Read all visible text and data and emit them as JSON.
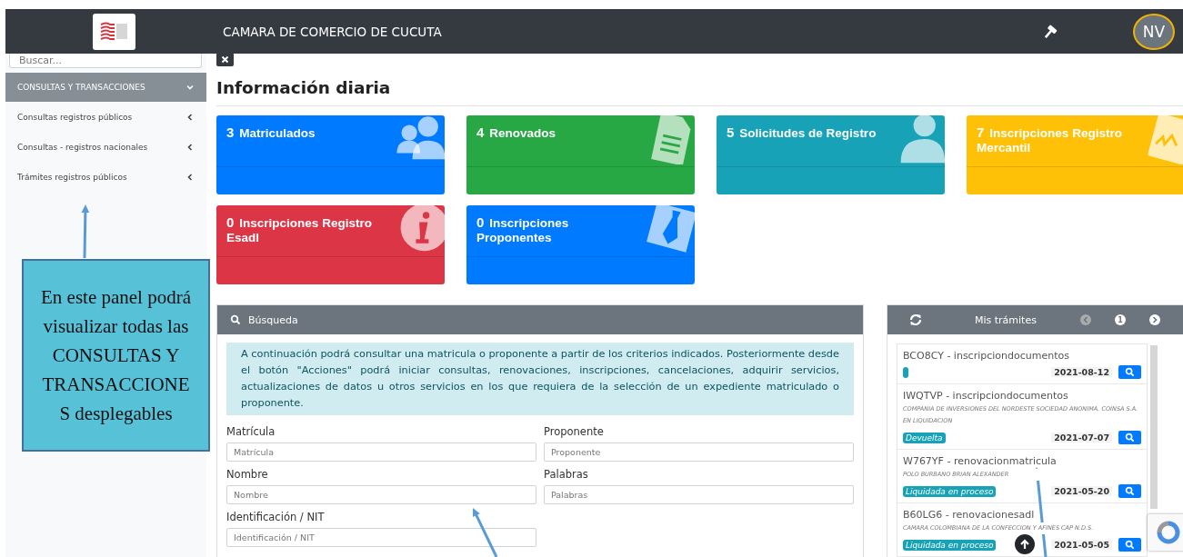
{
  "header": {
    "title": "CAMARA DE COMERCIO DE CUCUTA",
    "user_initials": "NV"
  },
  "sidebar": {
    "search_placeholder": "Buscar...",
    "section": {
      "label": "CONSULTAS Y TRANSACCIONES",
      "expanded": true,
      "children": [
        {
          "label": "Consultas registros públicos",
          "expanded": false
        },
        {
          "label": "Consultas - registros nacionales",
          "expanded": false
        },
        {
          "label": "Trámites registros públicos",
          "expanded": false
        }
      ]
    }
  },
  "page_title": "Información diaria",
  "stat_cards": [
    {
      "count": "3",
      "label": "Matriculados",
      "color": "#007bff",
      "kind": "users"
    },
    {
      "count": "4",
      "label": "Renovados",
      "color": "#28a745",
      "kind": "document"
    },
    {
      "count": "5",
      "label": "Solicitudes de Registro",
      "color": "#17a2b8",
      "kind": "user"
    },
    {
      "count": "7",
      "label": "Inscripciones Registro Mercantil",
      "color": "#ffc107",
      "kind": "signature"
    },
    {
      "count": "0",
      "label": "Inscripciones Registro Esadl",
      "color": "#dc3545",
      "kind": "info"
    },
    {
      "count": "0",
      "label": "Inscripciones Proponentes",
      "color": "#007bff",
      "kind": "tie"
    }
  ],
  "search_panel": {
    "title": "Búsqueda",
    "info": "A continuación podrá consultar una matricula o proponente a partir de los criterios indicados. Posteriormente desde el botón \"Acciones\" podrá iniciar consultas, renovaciones, inscripciones, cancelaciones, adquirir servicios, actualizaciones de datos u otros servicios en los que requiera de la selección de un expediente matriculado o proponente.",
    "fields": [
      {
        "label": "Matrícula",
        "placeholder": "Matrícula"
      },
      {
        "label": "Proponente",
        "placeholder": "Proponente"
      },
      {
        "label": "Nombre",
        "placeholder": "Nombre"
      },
      {
        "label": "Palabras",
        "placeholder": "Palabras"
      },
      {
        "label": "Identificación / NIT",
        "placeholder": "Identificación / NIT"
      }
    ]
  },
  "tramites_panel": {
    "title": "Mis trámites",
    "page": "1",
    "items": [
      {
        "title": "BCO8CY - inscripciondocumentos",
        "status_marker": true,
        "date": "2021-08-12"
      },
      {
        "title": "IWQTVP - inscripciondocumentos",
        "owner": "COMPANIA DE INVERSIONES DEL NORDESTE SOCIEDAD ANONIMA. COINSA S.A. EN LIQUIDACION",
        "status": "Devuelta",
        "date": "2021-07-07"
      },
      {
        "title": "W767YF - renovacionmatricula",
        "owner": "POLO BURBANO BRIAN ALEXANDER",
        "status": "Liquidada en proceso",
        "date": "2021-05-20"
      },
      {
        "title": "B60LG6 - renovacionesadl",
        "owner": "CAMARA COLOMBIANA DE LA CONFECCION Y AFINES CAP N.D.S.",
        "status": "Liquidada en proceso",
        "date": "2021-05-05"
      }
    ]
  },
  "annotation": {
    "callout": "En este panel podrá visualizar todas las CONSULTAS Y TRANSACCIONES desplegables"
  }
}
